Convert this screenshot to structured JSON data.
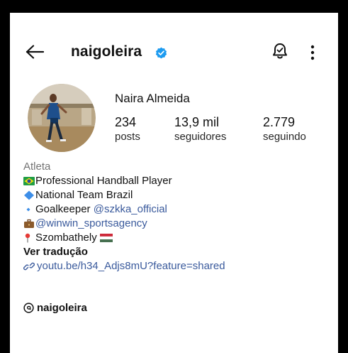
{
  "header": {
    "username": "naigoleira",
    "back_icon": "arrow-left-icon",
    "verified_icon": "verified-badge-icon",
    "notification_icon": "bell-icon",
    "more_icon": "more-vertical-icon"
  },
  "profile": {
    "display_name": "Naira Almeida",
    "stats": [
      {
        "value": "234",
        "label": "posts"
      },
      {
        "value": "13,9 mil",
        "label": "seguidores"
      },
      {
        "value": "2.779",
        "label": "seguindo"
      }
    ]
  },
  "bio": {
    "category": "Atleta",
    "lines": [
      {
        "icon": "brazil-flag-icon",
        "text": "Professional Handball  Player"
      },
      {
        "icon": "blue-diamond-icon",
        "text": "National Team Brazil"
      },
      {
        "icon": "small-blue-diamond-icon",
        "text": "Goalkeeper ",
        "mention": "@szkka_official"
      },
      {
        "icon": "briefcase-icon",
        "mention": "@winwin_sportsagency"
      },
      {
        "icon": "pin-icon",
        "text": "Szombathely ",
        "trailing_icon": "hungary-flag-icon"
      }
    ],
    "translate_label": "Ver tradução",
    "link_icon": "link-icon",
    "link": "youtu.be/h34_Adjs8mU?feature=shared"
  },
  "threads": {
    "icon": "threads-icon",
    "label": "naigoleira"
  },
  "colors": {
    "link": "#3a5a9c",
    "verified": "#1d9bf0",
    "category": "#737373"
  }
}
